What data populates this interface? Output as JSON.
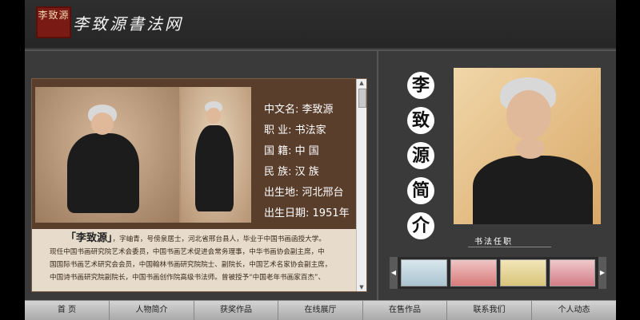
{
  "header": {
    "seal_text": "李致源",
    "site_title": "李致源書法网"
  },
  "profile": {
    "rows": [
      {
        "label": "中文名:",
        "value": "李致源"
      },
      {
        "label": "职  业:",
        "value": "书法家"
      },
      {
        "label": "国  籍:",
        "value": "中  国"
      },
      {
        "label": "民  族:",
        "value": "汉  族"
      },
      {
        "label": "出生地:",
        "value": "河北邢台"
      },
      {
        "label": "出生日期:",
        "value": "1951年"
      }
    ],
    "bio_name": "「李致源」",
    "bio_lines": [
      "，字岫青，号傍泉居士，河北省邢台县人，毕业于中国书画函授大学。",
      "现任中国书画研究院艺术会委员，中国书画艺术促进会常务理事，中华书画协会副主席，中",
      "国国际书画艺术研究会会员，中国翰林书画研究院院士、副院长，中国艺术名家协会副主席，",
      "中国诗书画研究院副院长，中国书画创作院高级书法师。曾被授予“中国老年书画家百杰”、"
    ]
  },
  "right_panel": {
    "title_chars": [
      "李",
      "致",
      "源",
      "简",
      "介"
    ],
    "subheading": "书法任职"
  },
  "nav": {
    "items": [
      "首  页",
      "人物简介",
      "获奖作品",
      "在线展厅",
      "在售作品",
      "联系我们",
      "个人动态"
    ]
  },
  "colors": {
    "accent_red": "#7a1a14",
    "panel_brown": "#5a3e2c",
    "background": "#3a3a3a"
  }
}
